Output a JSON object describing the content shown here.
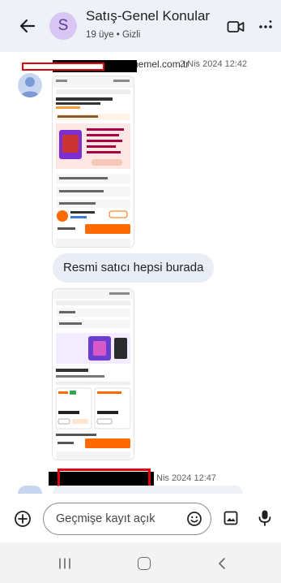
{
  "header": {
    "avatar_letter": "S",
    "title": "Satış-Genel Konular",
    "subtitle": "19 üye • Gizli"
  },
  "messages": [
    {
      "sender_visible": "hemel.com.tr",
      "timestamp": "2 Nis 2024 12:42"
    },
    {
      "text": "Resmi satıcı hepsi burada"
    },
    {
      "timestamp": "Nis 2024 12:47"
    }
  ],
  "shot1": {
    "tab_label": "Ürün Açıklamaları",
    "product_title": "CASE Oled Platinum · Oled Tamdejem 1.TB",
    "store_name": "Hepsiburada",
    "price": "Ekle ve Öde",
    "buy_button": "Sepete ekle"
  },
  "shot2": {
    "store_header": "Mağaza",
    "section_title": "Diğer Satıcılar",
    "price_left": "₺ 54,99 TL",
    "price_right": "₺ 54,00 TL",
    "buy_button": "Sepete ekle"
  },
  "composer": {
    "placeholder": "Geçmişe kayıt açık"
  },
  "colors": {
    "header_bg": "#eef1f8",
    "bubble_bg": "#e9edf5",
    "accent_orange": "#ff6a00",
    "avatar_purple": "#d9c7f3",
    "redaction": "#e3000f"
  },
  "icons": {
    "back": "arrow-left-icon",
    "video": "video-camera-icon",
    "more": "more-vert-icon",
    "add": "add-circle-icon",
    "emoji": "emoji-icon",
    "image": "image-icon",
    "mic": "mic-icon"
  }
}
